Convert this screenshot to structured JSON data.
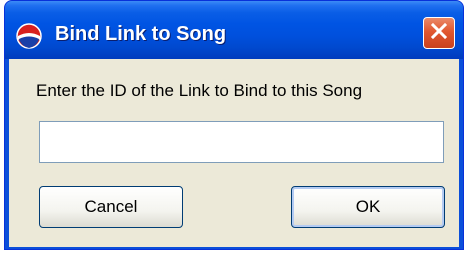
{
  "window": {
    "title": "Bind Link to Song",
    "icon": "app-icon",
    "close_icon": "close-icon"
  },
  "dialog": {
    "prompt": "Enter the ID of the Link to Bind to this Song",
    "input_value": "",
    "cancel_label": "Cancel",
    "ok_label": "OK"
  },
  "colors": {
    "titlebar": "#0054e3",
    "close_button": "#e1572f",
    "client_background": "#ece9d8"
  }
}
